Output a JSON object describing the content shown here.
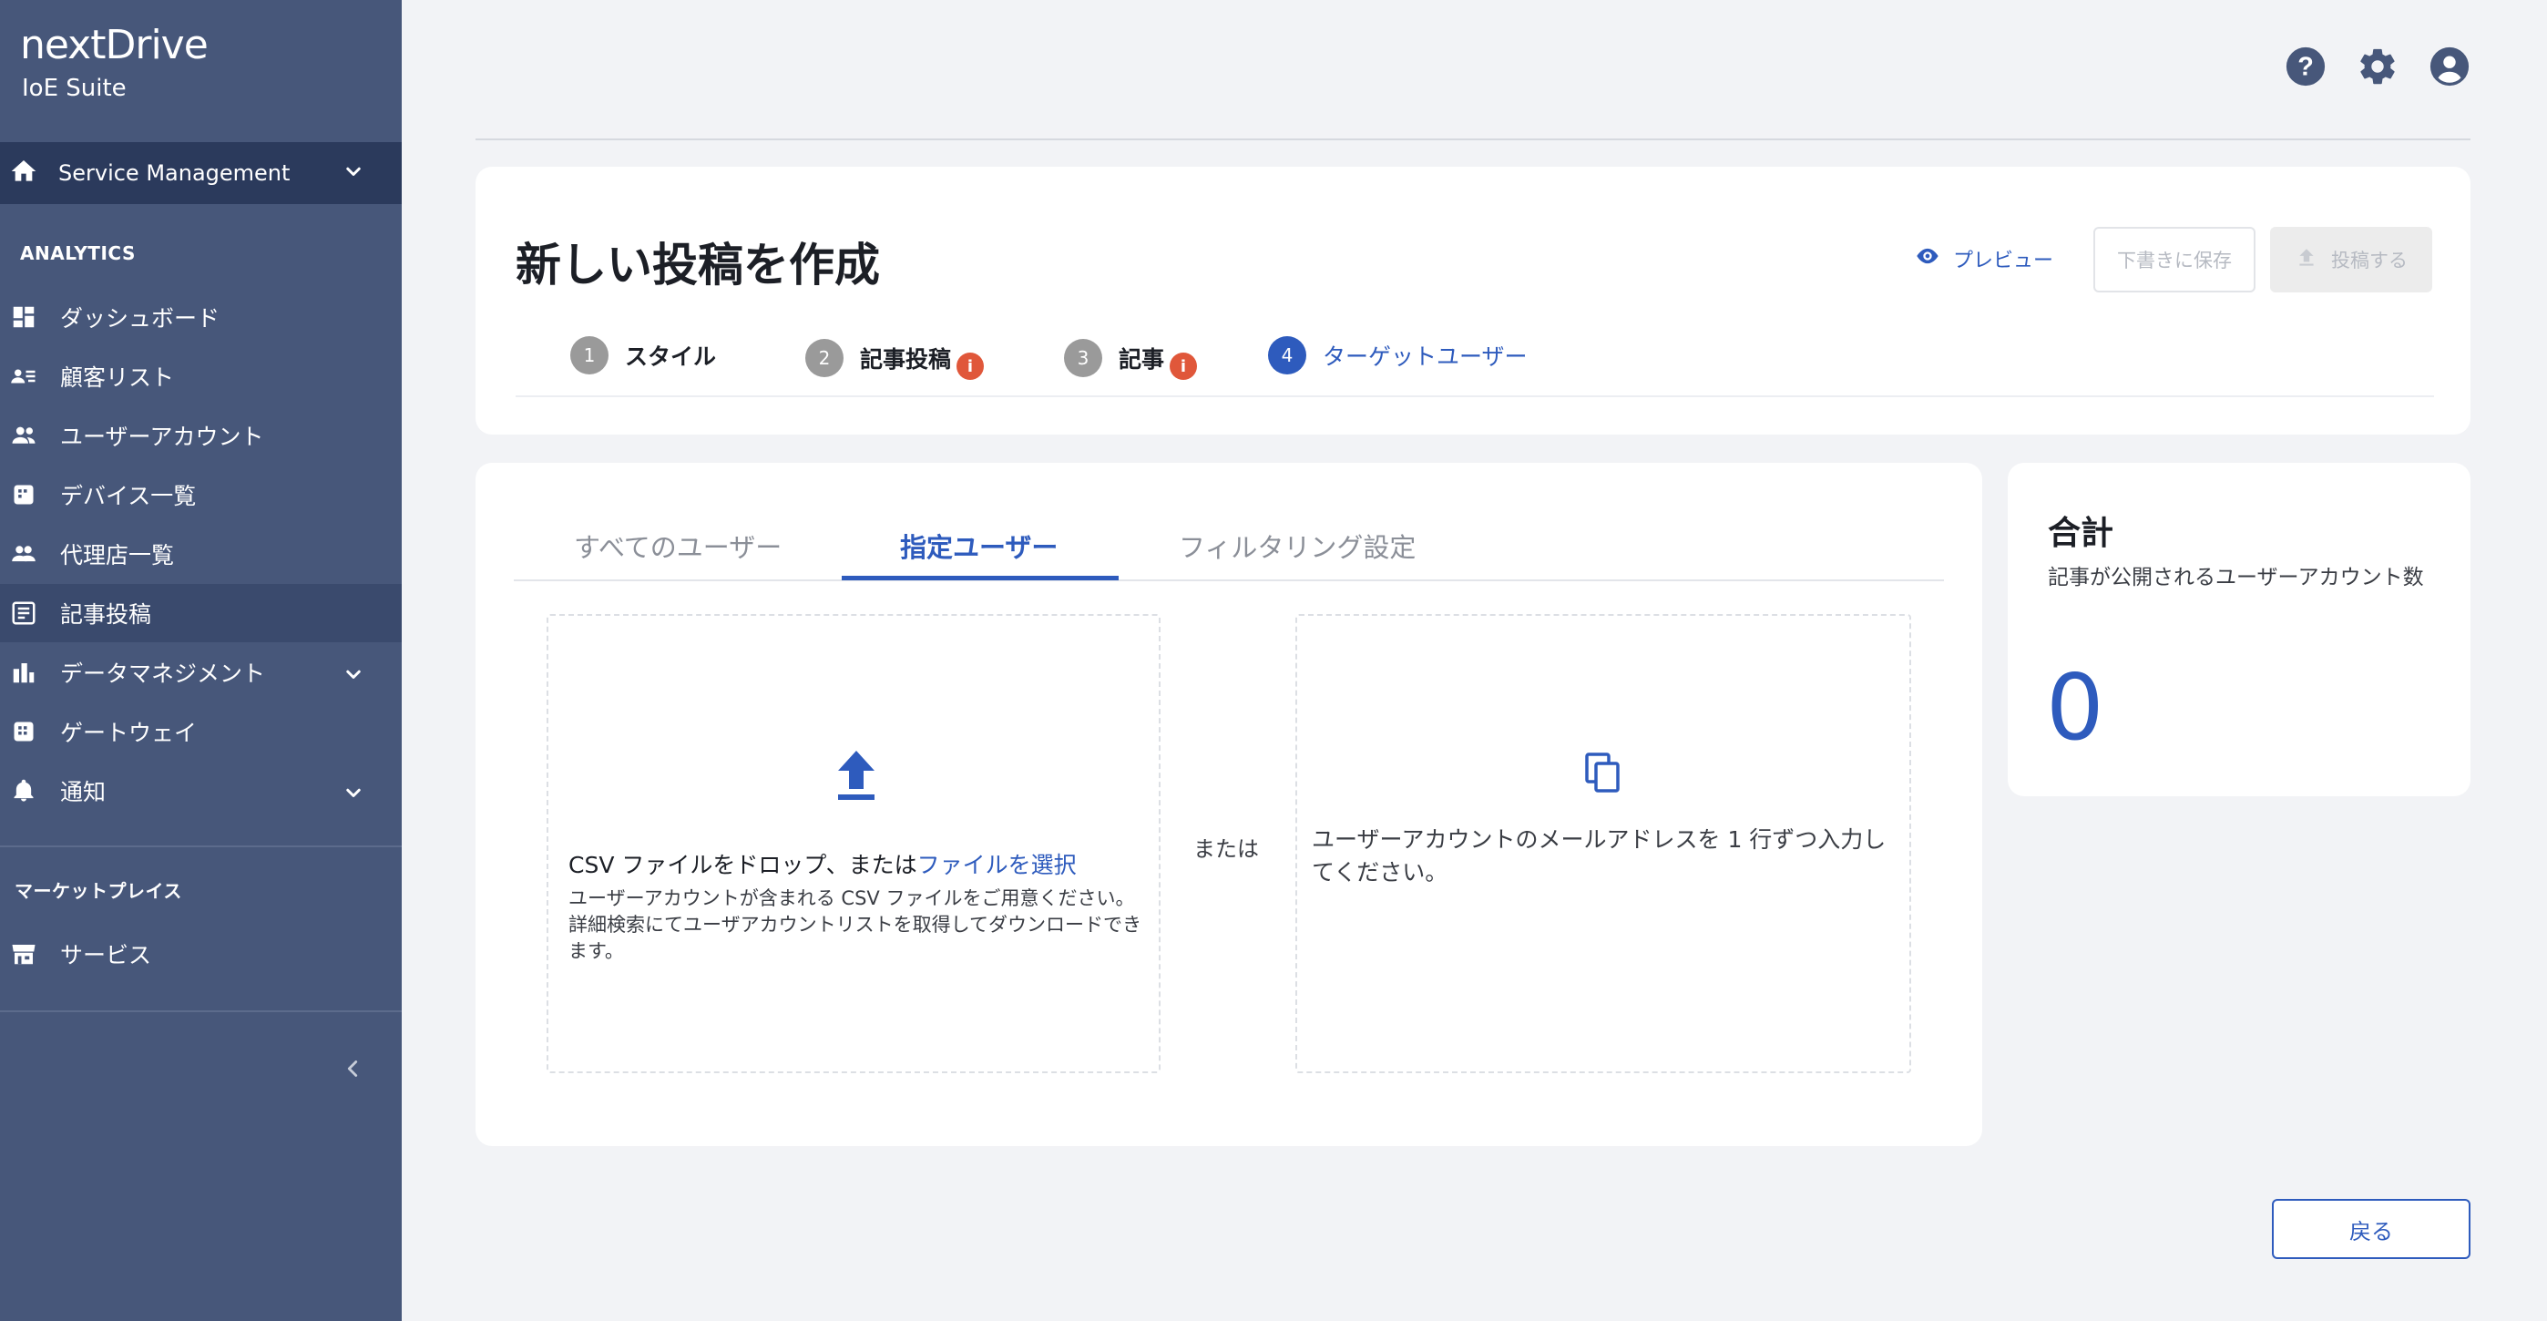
{
  "app": {
    "logo": "nextDrive",
    "suite": "IoE Suite"
  },
  "sidebar": {
    "service_management": "Service Management",
    "analytics_title": "ANALYTICS",
    "items": [
      {
        "label": "ダッシュボード",
        "icon": "dashboard-icon"
      },
      {
        "label": "顧客リスト",
        "icon": "customer-list-icon"
      },
      {
        "label": "ユーザーアカウント",
        "icon": "users-icon"
      },
      {
        "label": "デバイス一覧",
        "icon": "device-icon"
      },
      {
        "label": "代理店一覧",
        "icon": "agency-icon"
      },
      {
        "label": "記事投稿",
        "icon": "article-icon",
        "active": true
      },
      {
        "label": "データマネジメント",
        "icon": "bar-chart-icon",
        "expandable": true
      },
      {
        "label": "ゲートウェイ",
        "icon": "gateway-icon"
      },
      {
        "label": "通知",
        "icon": "bell-icon",
        "expandable": true
      }
    ],
    "marketplace_title": "マーケットプレイス",
    "marketplace_items": [
      {
        "label": "サービス",
        "icon": "store-icon"
      }
    ]
  },
  "header": {
    "title": "新しい投稿を作成",
    "preview_label": "プレビュー",
    "save_draft_label": "下書きに保存",
    "post_label": "投稿する",
    "steps": [
      {
        "num": "1",
        "label": "スタイル",
        "warning": false,
        "active": false
      },
      {
        "num": "2",
        "label": "記事投稿",
        "warning": true,
        "active": false
      },
      {
        "num": "3",
        "label": "記事",
        "warning": true,
        "active": false
      },
      {
        "num": "4",
        "label": "ターゲットユーザー",
        "warning": false,
        "active": true
      }
    ],
    "warning_glyph": "i"
  },
  "main": {
    "tabs": [
      "すべてのユーザー",
      "指定ユーザー",
      "フィルタリング設定"
    ],
    "active_tab": "指定ユーザー",
    "drop_text": "CSV ファイルをドロップ、または",
    "drop_link": "ファイルを選択",
    "drop_help": "ユーザーアカウントが含まれる CSV ファイルをご用意ください。詳細検索にてユーザアカウントリストを取得してダウンロードできます。",
    "or_text": "または",
    "email_help": "ユーザーアカウントのメールアドレスを 1 行ずつ入力してください。"
  },
  "total": {
    "title": "合計",
    "description": "記事が公開されるユーザーアカウント数",
    "value": "0"
  },
  "footer": {
    "back_label": "戻る"
  },
  "colors": {
    "sidebar_bg": "#47577a",
    "sidebar_active": "#2b3a5c",
    "accent": "#2e5bbd",
    "warning": "#e0573a"
  }
}
